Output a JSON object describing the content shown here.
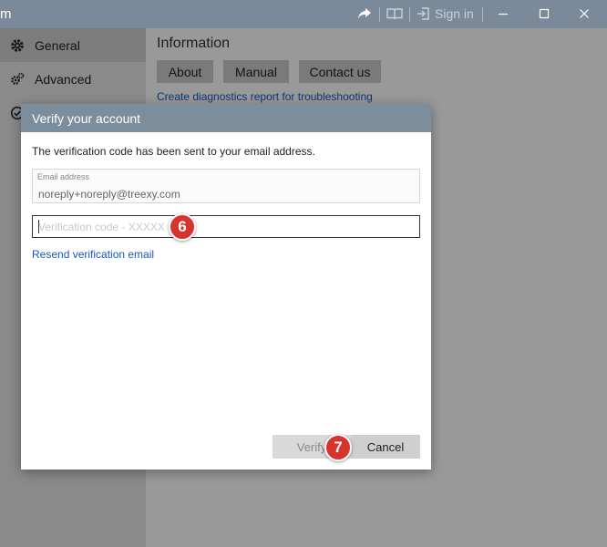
{
  "titlebar": {
    "app_title_fragment": "m",
    "share_icon": "share-arrow-icon",
    "book_icon": "book-icon",
    "signin_icon": "sign-in-icon",
    "signin_label": "Sign in",
    "window_controls": [
      "minimize-icon",
      "maximize-icon",
      "close-icon"
    ]
  },
  "sidebar": {
    "items": [
      {
        "label": "General",
        "icon": "gear-icon",
        "active": true
      },
      {
        "label": "Advanced",
        "icon": "gears-icon",
        "active": false
      },
      {
        "label": "",
        "icon": "check-circle-icon",
        "active": false
      }
    ]
  },
  "main": {
    "section_title": "Information",
    "buttons": [
      "About",
      "Manual",
      "Contact us"
    ],
    "diagnostics_link": "Create diagnostics report for troubleshooting"
  },
  "dialog": {
    "title": "Verify your account",
    "message": "The verification code has been sent to your email address.",
    "email_label": "Email address",
    "email_value": "noreply+noreply@treexy.com",
    "code_placeholder": "Verification code - XXXXX",
    "resend_link": "Resend verification email",
    "verify_label": "Verify",
    "cancel_label": "Cancel"
  },
  "markers": [
    "6",
    "7"
  ],
  "colors": {
    "titlebar": "#7a8a9a",
    "dialog_header": "#7c8d9c",
    "link": "#1a56c8",
    "marker": "#d9342b"
  }
}
